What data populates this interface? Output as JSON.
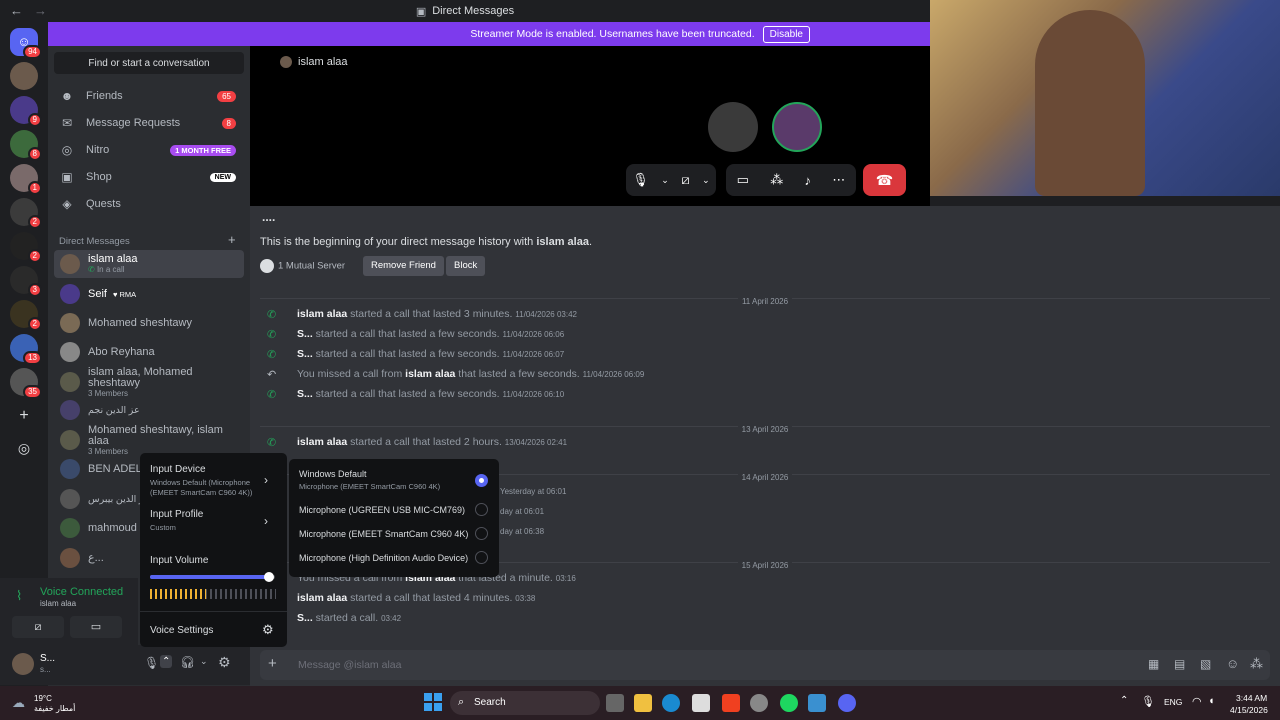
{
  "window": {
    "title": "Direct Messages",
    "back": "←",
    "forward": "→"
  },
  "banner": {
    "text": "Streamer Mode is enabled. Usernames have been truncated.",
    "button": "Disable"
  },
  "servers": {
    "badges": [
      "94",
      "",
      "9",
      "8",
      "1",
      "2",
      "2",
      "3",
      "2",
      "13",
      "35"
    ]
  },
  "sidebar": {
    "find": "Find or start a conversation",
    "nav": [
      {
        "label": "Friends",
        "icon": "friends-icon",
        "badge": "65"
      },
      {
        "label": "Message Requests",
        "icon": "mail-icon",
        "badge": "8"
      },
      {
        "label": "Nitro",
        "icon": "nitro-icon",
        "badge": "1 MONTH FREE"
      },
      {
        "label": "Shop",
        "icon": "shop-icon",
        "badge": "NEW"
      },
      {
        "label": "Quests",
        "icon": "quests-icon",
        "badge": ""
      }
    ],
    "dm_header": "Direct Messages",
    "dms": [
      {
        "name": "islam alaa",
        "sub": "In a call"
      },
      {
        "name": "Seif",
        "sub": "",
        "tag": "RMA"
      },
      {
        "name": "Mohamed sheshtawy",
        "sub": ""
      },
      {
        "name": "Abo Reyhana",
        "sub": ""
      },
      {
        "name": "islam alaa, Mohamed sheshtawy",
        "sub": "3 Members"
      },
      {
        "name": "عز الدين نجم",
        "sub": ""
      },
      {
        "name": "Mohamed sheshtawy, islam alaa",
        "sub": "3 Members"
      },
      {
        "name": "BEN ADEL",
        "sub": ""
      },
      {
        "name": "عز الدين بيبرس",
        "sub": ""
      },
      {
        "name": "mahmoud",
        "sub": ""
      },
      {
        "name": "ع...",
        "sub": ""
      }
    ]
  },
  "voice": {
    "status": "Voice Connected",
    "channel": "islam alaa"
  },
  "user": {
    "name": "S...",
    "status": "s..."
  },
  "call": {
    "name": "islam alaa",
    "end_icon": "hangup-icon"
  },
  "chat": {
    "dots": "....",
    "beginning_prefix": "This is the beginning of your direct message history with ",
    "beginning_name": "islam alaa",
    "beginning_suffix": ".",
    "mutual": "1 Mutual Server",
    "remove_friend": "Remove Friend",
    "block": "Block",
    "dates": [
      "11 April 2026",
      "13 April 2026",
      "14 April 2026",
      "15 April 2026"
    ],
    "messages": [
      {
        "who": "islam alaa",
        "text": " started a call that lasted 3 minutes.",
        "time": "11/04/2026 03:42",
        "missed": false
      },
      {
        "who": "S...",
        "text": " started a call that lasted a few seconds.",
        "time": "11/04/2026 06:06",
        "missed": false
      },
      {
        "who": "S...",
        "text": " started a call that lasted a few seconds.",
        "time": "11/04/2026 06:07",
        "missed": false
      },
      {
        "pre": "You missed a call from ",
        "who": "islam alaa",
        "text": " that lasted a few seconds.",
        "time": "11/04/2026 06:09",
        "missed": true
      },
      {
        "who": "S...",
        "text": " started a call that lasted a few seconds.",
        "time": "11/04/2026 06:10",
        "missed": false
      },
      {
        "who": "islam alaa",
        "text": " started a call that lasted 2 hours.",
        "time": "13/04/2026 02:41",
        "missed": false
      },
      {
        "who": "",
        "text": "",
        "time": "Yesterday at 06:01",
        "missed": false
      },
      {
        "who": "",
        "text": "",
        "time": "day at 06:01",
        "missed": false
      },
      {
        "who": "",
        "text": "",
        "time": "day at 06:38",
        "missed": false
      },
      {
        "pre": "You missed a call from ",
        "who": "islam alaa",
        "text": " that lasted a minute.",
        "time": "03:16",
        "missed": true
      },
      {
        "who": "islam alaa",
        "text": " started a call that lasted 4 minutes.",
        "time": "03:38",
        "missed": false
      },
      {
        "who": "S...",
        "text": " started a call.",
        "time": "03:42",
        "missed": false
      }
    ],
    "input_placeholder": "Message @islam alaa"
  },
  "input_menu": {
    "device_label": "Input Device",
    "device_value": "Windows Default (Microphone (EMEET SmartCam C960 4K))",
    "profile_label": "Input Profile",
    "profile_value": "Custom",
    "volume_label": "Input Volume",
    "volume": 0.95,
    "settings": "Voice Settings"
  },
  "device_menu": {
    "options": [
      {
        "label": "Windows Default",
        "sub": "Microphone (EMEET SmartCam C960 4K)",
        "selected": true
      },
      {
        "label": "Microphone (UGREEN USB MIC-CM769)",
        "sub": "",
        "selected": false
      },
      {
        "label": "Microphone (EMEET SmartCam C960 4K)",
        "sub": "",
        "selected": false
      },
      {
        "label": "Microphone (High Definition Audio Device)",
        "sub": "",
        "selected": false
      }
    ]
  },
  "taskbar": {
    "weather_temp": "19°C",
    "weather_text": "أمطار خفيفة",
    "search": "Search",
    "lang": "ENG",
    "time": "3:44 AM",
    "date": "4/15/2026"
  },
  "colors": {
    "accent": "#5865f2",
    "banner": "#7d3bed",
    "green": "#23a55a",
    "red": "#da373c"
  }
}
